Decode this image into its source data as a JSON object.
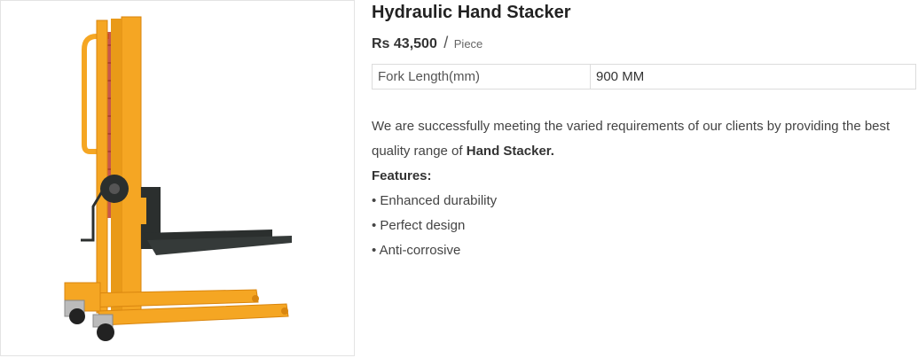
{
  "product": {
    "title": "Hydraulic Hand Stacker",
    "price": "Rs 43,500",
    "price_separator": "/",
    "unit": "Piece",
    "image_alt": "Hydraulic hand stacker",
    "specs": [
      {
        "key": "Fork Length(mm)",
        "value": "900 MM"
      }
    ],
    "description_prefix": "We are successfully meeting the varied requirements of our clients by providing the best quality range of ",
    "description_bold": "Hand Stacker.",
    "features_title": "Features:",
    "features": [
      "• Enhanced durability",
      "• Perfect design",
      "• Anti-corrosive"
    ]
  },
  "colors": {
    "frame": "#f5a623",
    "frame_dark": "#d9860f",
    "fork": "#2b2f2e",
    "spring": "#c0392b"
  }
}
